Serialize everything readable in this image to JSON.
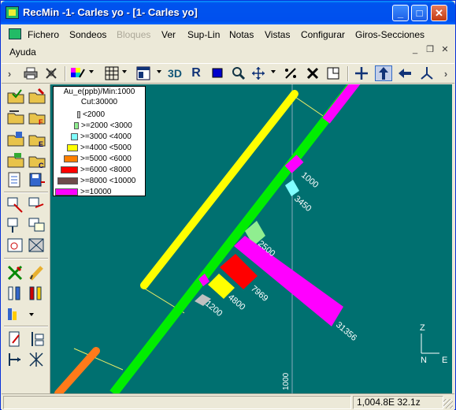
{
  "window": {
    "title": "RecMin -1- Carles yo - [1- Carles yo]"
  },
  "titlebar_buttons": {
    "minimize": "_",
    "maximize": "□",
    "close": "✕"
  },
  "menubar": {
    "items": [
      {
        "label": "Fichero",
        "enabled": true
      },
      {
        "label": "Sondeos",
        "enabled": true
      },
      {
        "label": "Bloques",
        "enabled": false
      },
      {
        "label": "Ver",
        "enabled": true
      },
      {
        "label": "Sup-Lin",
        "enabled": true
      },
      {
        "label": "Notas",
        "enabled": true
      },
      {
        "label": "Vistas",
        "enabled": true
      },
      {
        "label": "Configurar",
        "enabled": true
      },
      {
        "label": "Giros-Secciones",
        "enabled": true
      },
      {
        "label": "Ayuda",
        "enabled": true
      }
    ],
    "mdi": {
      "minimize": "_",
      "restore": "❐",
      "close": "✕"
    }
  },
  "toolbar": {
    "grip": "›",
    "print_icon": "printer-icon",
    "label_3d": "3D",
    "label_r": "R",
    "overflow": "›"
  },
  "legend": {
    "title": "Au_e(ppb)/Min:1000",
    "cut": "Cut:30000",
    "entries": [
      {
        "label": "<2000",
        "color": "#c0c0c0"
      },
      {
        "label": ">=2000 <3000",
        "color": "#90ee90"
      },
      {
        "label": ">=3000 <4000",
        "color": "#80ffff"
      },
      {
        "label": ">=4000 <5000",
        "color": "#ffff00"
      },
      {
        "label": ">=5000 <6000",
        "color": "#ff8000"
      },
      {
        "label": ">=6000 <8000",
        "color": "#ff0000"
      },
      {
        "label": ">=8000 <10000",
        "color": "#6e4a4a"
      },
      {
        "label": ">=10000",
        "color": "#ff00ff"
      }
    ]
  },
  "canvas": {
    "background": "#007070",
    "samples": [
      "1000",
      "3450",
      "2500",
      "7969",
      "4800",
      "1200",
      "31356"
    ],
    "gridline_label": "1000",
    "axes": {
      "z": "Z",
      "n": "N",
      "e": "E"
    }
  },
  "statusbar": {
    "coords": "1,004.8E 32.1z"
  }
}
